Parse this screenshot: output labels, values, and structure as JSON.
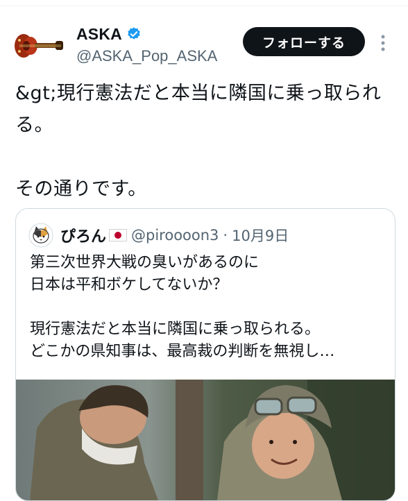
{
  "tweet": {
    "author": {
      "display_name": "ASKA",
      "handle": "@ASKA_Pop_ASKA",
      "verified": true,
      "avatar_icon": "violin-bass-guitar-avatar"
    },
    "follow_label": "フォローする",
    "text_lines": [
      "&gt;現行憲法だと本当に隣国に乗っ取られ",
      "る。",
      "",
      "その通りです。"
    ]
  },
  "quoted_tweet": {
    "display_name": "ぴろん",
    "flag_icon": "japan-flag-icon",
    "handle": "@piroooon3",
    "separator": "·",
    "date": "10月9日",
    "text_lines": [
      "第三次世界大戦の臭いがあるのに",
      "日本は平和ボケしてないか？",
      "",
      "現行憲法だと本当に隣国に乗っ取られる。",
      "どこかの県知事は、最高裁の判断を無視し…"
    ]
  },
  "colors": {
    "text_primary": "#0f1419",
    "text_secondary": "#536471",
    "verified_blue": "#1d9bf0",
    "follow_bg": "#0f1419",
    "border": "#cfd9de"
  }
}
